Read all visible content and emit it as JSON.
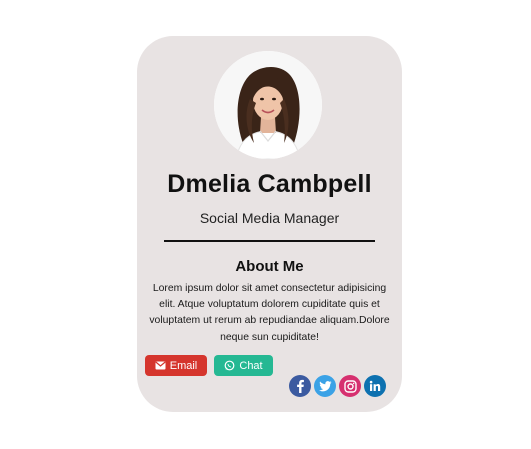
{
  "profile": {
    "name": "Dmelia Cambpell",
    "role": "Social Media Manager"
  },
  "about": {
    "heading": "About Me",
    "text": "Lorem ipsum dolor sit amet consectetur adipisicing elit. Atque voluptatum dolorem cupiditate quis et voluptatem ut rerum ab repudiandae aliquam.Dolore neque sun cupiditate!"
  },
  "buttons": {
    "email_label": "Email",
    "chat_label": "Chat"
  },
  "socials": [
    {
      "icon": "facebook-icon",
      "color": "#3b5aa0"
    },
    {
      "icon": "twitter-icon",
      "color": "#3ba2e6"
    },
    {
      "icon": "instagram-icon",
      "color": "#d6306f"
    },
    {
      "icon": "linkedin-icon",
      "color": "#0d71b0"
    }
  ],
  "colors": {
    "card_background": "#e8e3e3",
    "email_button": "#d5352d",
    "chat_button": "#25b893"
  }
}
